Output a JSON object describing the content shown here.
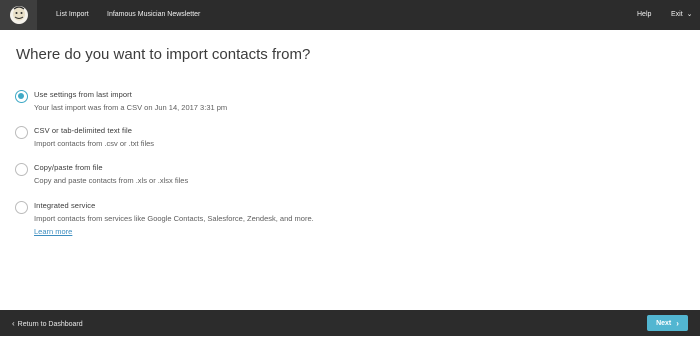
{
  "topbar": {
    "logo_icon": "mailchimp-logo-icon",
    "list_import": "List Import",
    "newsletter": "Infamous Musician Newsletter",
    "help": "Help",
    "exit": "Exit",
    "exit_caret": "⌄"
  },
  "main": {
    "title": "Where do you want to import contacts from?",
    "options": [
      {
        "label": "Use settings from last import",
        "description": "Your last import was from a CSV on Jun 14, 2017 3:31 pm",
        "selected": true
      },
      {
        "label": "CSV or tab-delimited text file",
        "description": "Import contacts from .csv or .txt files",
        "selected": false
      },
      {
        "label": "Copy/paste from file",
        "description": "Copy and paste contacts from .xls or .xlsx files",
        "selected": false
      },
      {
        "label": "Integrated service",
        "description": "Import contacts from services like Google Contacts, Salesforce, Zendesk, and more.",
        "link": "Learn more",
        "selected": false
      }
    ]
  },
  "footer": {
    "back_chevron": "‹",
    "back_label": "Return to Dashboard",
    "next_label": "Next",
    "next_chevron": "›"
  },
  "colors": {
    "topbar_bg": "#2c2c2c",
    "accent": "#3fa9c6",
    "next_button": "#52b6d1",
    "link": "#3c8dbf"
  }
}
